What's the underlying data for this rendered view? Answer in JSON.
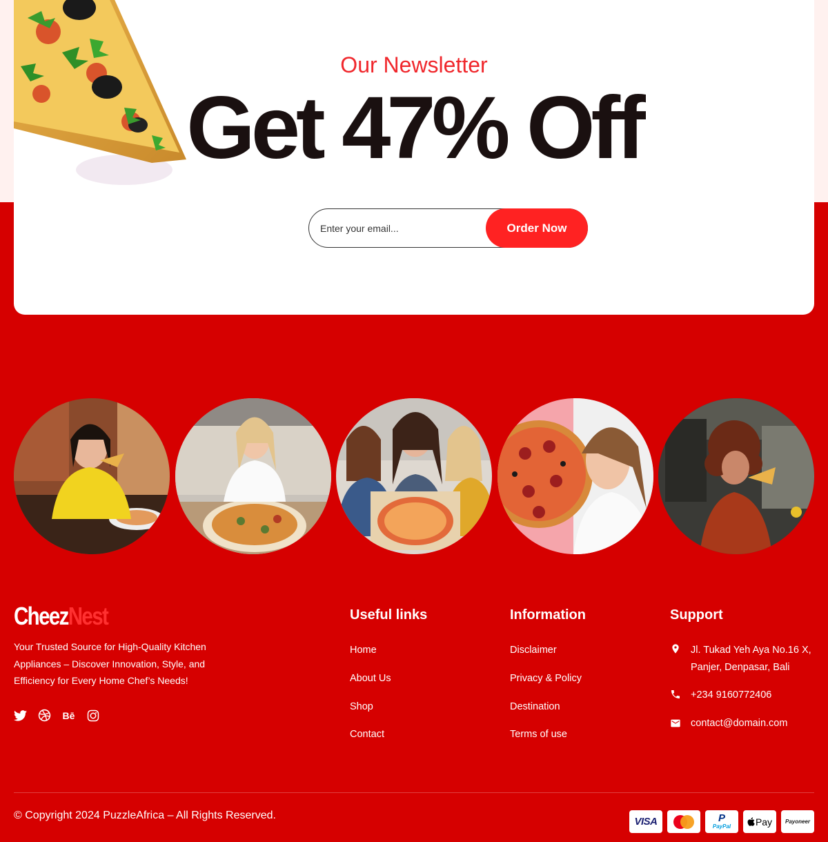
{
  "newsletter": {
    "title": "Our Newsletter",
    "headline": "Get 47% Off",
    "email_placeholder": "Enter your email...",
    "button_label": "Order Now"
  },
  "gallery": [
    {
      "icon": "woman-eating-pizza-yellow-sweater"
    },
    {
      "icon": "woman-eating-pizza-couch"
    },
    {
      "icon": "three-women-pizza-box"
    },
    {
      "icon": "woman-with-pepperoni-pizza"
    },
    {
      "icon": "woman-eating-pizza-kitchen"
    }
  ],
  "footer": {
    "brand_part1": "Cheez",
    "brand_part2": "Nest",
    "tagline": "Your Trusted Source for High-Quality Kitchen Appliances – Discover Innovation, Style, and Efficiency for Every Home Chef’s Needs!",
    "socials": [
      {
        "icon": "twitter-icon"
      },
      {
        "icon": "dribbble-icon"
      },
      {
        "icon": "behance-icon",
        "label": "Bē"
      },
      {
        "icon": "instagram-icon"
      }
    ],
    "useful_links": {
      "title": "Useful links",
      "items": [
        "Home",
        "About Us",
        "Shop",
        "Contact"
      ]
    },
    "information": {
      "title": "Information",
      "items": [
        "Disclaimer",
        "Privacy & Policy",
        "Destination",
        "Terms of use"
      ]
    },
    "support": {
      "title": "Support",
      "address": "Jl. Tukad Yeh Aya No.16 X, Panjer, Denpasar, Bali",
      "phone": "+234 9160772406",
      "email": "contact@domain.com"
    },
    "copyright": "© Copyright 2024 PuzzleAfrica – All Rights Reserved.",
    "payments": [
      {
        "icon": "visa-icon",
        "label": "VISA"
      },
      {
        "icon": "mastercard-icon"
      },
      {
        "icon": "paypal-icon",
        "label": "PayPal"
      },
      {
        "icon": "apple-pay-icon",
        "label": "Pay"
      },
      {
        "icon": "payoneer-icon",
        "label": "Payoneer"
      }
    ]
  },
  "colors": {
    "brand_red": "#d60000",
    "accent_red": "#ff2222",
    "title_red": "#f0272c"
  }
}
